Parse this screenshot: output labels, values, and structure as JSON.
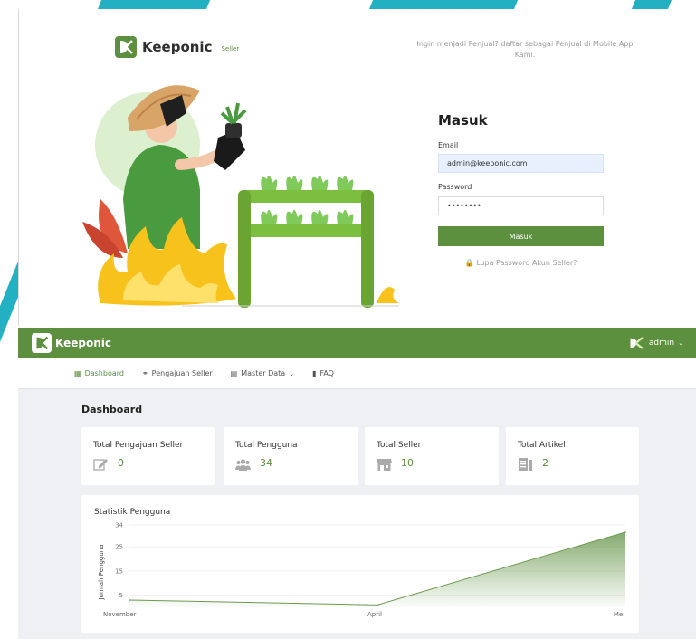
{
  "login": {
    "brand_name": "Keeponic",
    "brand_sub": "Seller",
    "promo_text": "Ingin menjadi Penjual? daftar sebagai Penjual di Mobile App Kami.",
    "title": "Masuk",
    "email_label": "Email",
    "email_value": "admin@keeponic.com",
    "password_label": "Password",
    "password_value": "••••••••",
    "submit_label": "Masuk",
    "forgot_label": "Lupa Password Akun Seller?"
  },
  "dashboard": {
    "app_name": "Keeponic",
    "user_name": "admin",
    "nav": [
      {
        "label": "Dashboard",
        "icon": "grid-icon"
      },
      {
        "label": "Pengajuan Seller",
        "icon": "user-upload-icon"
      },
      {
        "label": "Master Data",
        "icon": "database-icon"
      },
      {
        "label": "FAQ",
        "icon": "chat-icon"
      }
    ],
    "page_title": "Dashboard",
    "stats": [
      {
        "label": "Total Pengajuan Seller",
        "value": "0",
        "icon": "edit-icon"
      },
      {
        "label": "Total Pengguna",
        "value": "34",
        "icon": "users-icon"
      },
      {
        "label": "Total Seller",
        "value": "10",
        "icon": "store-icon"
      },
      {
        "label": "Total Artikel",
        "value": "2",
        "icon": "article-icon"
      }
    ],
    "chart_title": "Statistik Pengguna"
  },
  "colors": {
    "brand_green": "#5c8f3e",
    "accent_teal": "#23b0c2"
  },
  "chart_data": {
    "type": "area",
    "title": "Statistik Pengguna",
    "ylabel": "Jumlah Pengguna",
    "xlabel": "",
    "x": [
      "November",
      "April",
      "Mei"
    ],
    "series": [
      {
        "values": [
          3,
          1,
          31
        ]
      }
    ],
    "ytick_labels": [
      "34",
      "25",
      "15",
      "5"
    ],
    "yticks": [
      34,
      25,
      15,
      5
    ],
    "ylim": [
      0,
      34
    ],
    "grid": true,
    "legend": "none"
  }
}
